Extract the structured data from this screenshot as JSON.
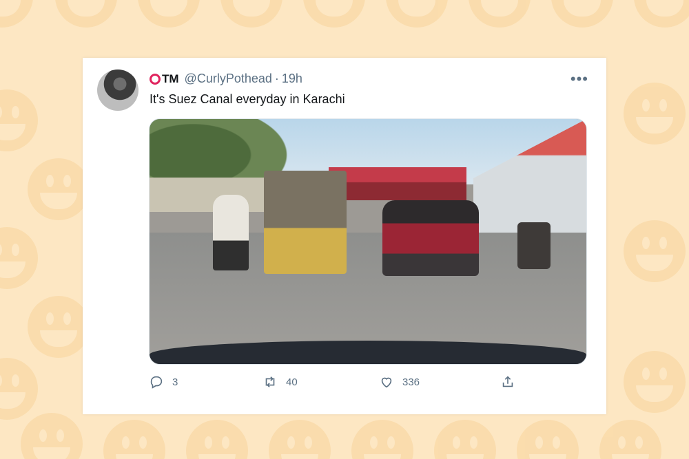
{
  "tweet": {
    "display_logo": "TM",
    "handle": "@CurlyPothead",
    "separator": "·",
    "time": "19h",
    "text": "It's Suez Canal everyday in Karachi",
    "more_label": "•••"
  },
  "actions": {
    "replies": "3",
    "retweets": "40",
    "likes": "336"
  },
  "colors": {
    "background": "#fde7c3",
    "logo_ring": "#e0245e",
    "muted_text": "#5b7083"
  },
  "icons": [
    "reply-icon",
    "retweet-icon",
    "like-icon",
    "share-icon"
  ]
}
